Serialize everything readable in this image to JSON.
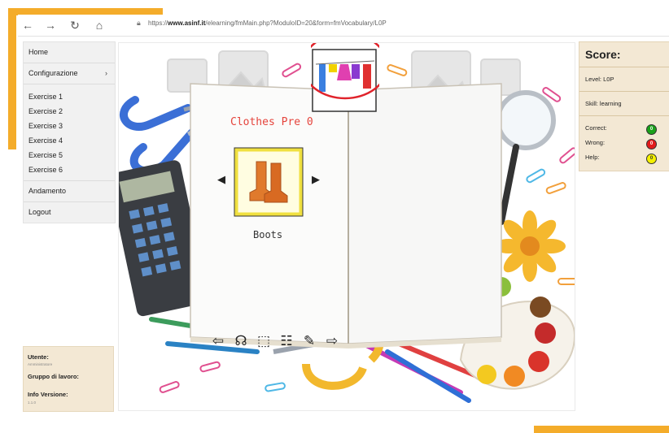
{
  "browser": {
    "back_icon": "arrow-left",
    "forward_icon": "arrow-right",
    "reload_icon": "reload",
    "home_icon": "home",
    "url_prefix": "https://",
    "url_domain": "www.asinf.it",
    "url_path": "/elearning/fmMain.php?ModuloID=20&form=fmVocabulary/L0P"
  },
  "menu": {
    "home": "Home",
    "config": "Configurazione",
    "config_caret": "›",
    "exercises": [
      "Exercise 1",
      "Exercise 2",
      "Exercise 3",
      "Exercise 4",
      "Exercise 5",
      "Exercise 6"
    ],
    "progress": "Andamento",
    "logout": "Logout"
  },
  "user": {
    "user_label": "Utente:",
    "user_value": "Amministratore",
    "group_label": "Gruppo di lavoro:",
    "version_label": "Info Versione:",
    "version_value": "1.1.0"
  },
  "lesson": {
    "title": "Clothes Pre 0",
    "word": "Boots"
  },
  "score": {
    "title": "Score:",
    "level": "Level: L0P",
    "skill": "Skill: learning",
    "correct_label": "Correct:",
    "correct_value": "0",
    "wrong_label": "Wrong:",
    "wrong_value": "0",
    "help_label": "Help:",
    "help_value": "0"
  },
  "colors": {
    "accent": "#f4ac2a",
    "title_red": "#e5443c",
    "correct": "#1aa11a",
    "wrong": "#e21b1b",
    "help": "#f4f000",
    "highlight": "#e0232b"
  }
}
